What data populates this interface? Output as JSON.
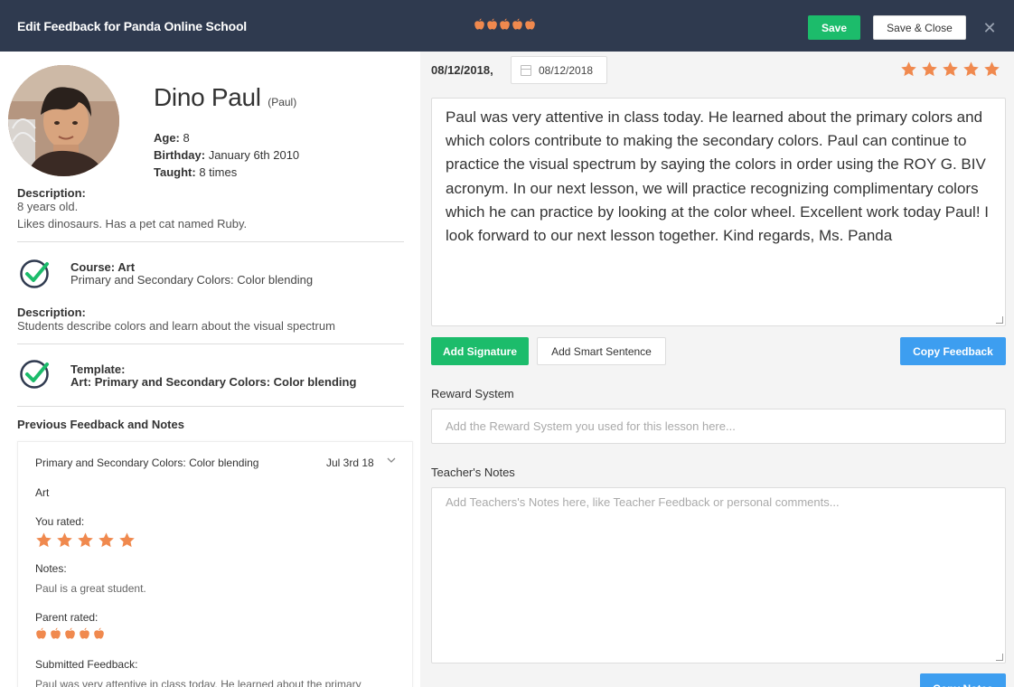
{
  "header": {
    "title": "Edit Feedback for Panda Online School",
    "parent_rating_apples": 5,
    "save_label": "Save",
    "save_close_label": "Save & Close",
    "close_icon": "close-icon"
  },
  "student": {
    "name": "Dino Paul",
    "nickname": "(Paul)",
    "age_label": "Age:",
    "age": "8",
    "birthday_label": "Birthday:",
    "birthday": "January 6th 2010",
    "taught_label": "Taught:",
    "taught": "8 times",
    "description_label": "Description:",
    "description_line1": "8 years old.",
    "description_line2": "Likes dinosaurs. Has a pet cat named Ruby."
  },
  "course": {
    "label": "Course:",
    "name": "Art",
    "title": "Primary and Secondary Colors: Color blending",
    "description_label": "Description:",
    "description": "Students describe colors and learn about the visual spectrum"
  },
  "template": {
    "label": "Template:",
    "value": "Art: Primary and Secondary Colors: Color blending"
  },
  "previous": {
    "section_title": "Previous Feedback and Notes",
    "card_title": "Primary and Secondary Colors: Color blending",
    "card_date": "Jul 3rd 18",
    "subject": "Art",
    "you_rated_label": "You rated:",
    "you_rated": 5,
    "notes_label": "Notes:",
    "notes": "Paul is a great student.",
    "parent_rated_label": "Parent rated:",
    "parent_rated": 5,
    "submitted_label": "Submitted Feedback:",
    "submitted_preview": "Paul was very attentive in class today. He learned about the primary"
  },
  "feedback": {
    "date_text": "08/12/2018,",
    "date_picker_value": "08/12/2018",
    "rating": 5,
    "text": "Paul was very attentive in class today. He learned about the primary colors and which colors contribute to making the secondary colors. Paul can continue to practice the visual spectrum by saying the colors in order using the ROY G. BIV acronym. In our next lesson, we will practice recognizing complimentary colors which he can practice by looking at the color wheel. Excellent work today Paul! I look forward to our next lesson together. Kind regards, Ms. Panda",
    "add_signature_label": "Add Signature",
    "add_smart_sentence_label": "Add Smart Sentence",
    "copy_feedback_label": "Copy Feedback"
  },
  "reward": {
    "label": "Reward System",
    "placeholder": "Add the Reward System you used for this lesson here..."
  },
  "notes": {
    "label": "Teacher's Notes",
    "placeholder": "Add Teachers's Notes here, like Teacher Feedback or personal comments...",
    "copy_notes_label": "Copy Notes"
  },
  "colors": {
    "header_bg": "#2f3a4f",
    "green": "#1cbc6b",
    "blue": "#3d9ef0",
    "star_orange": "#f0894e"
  }
}
